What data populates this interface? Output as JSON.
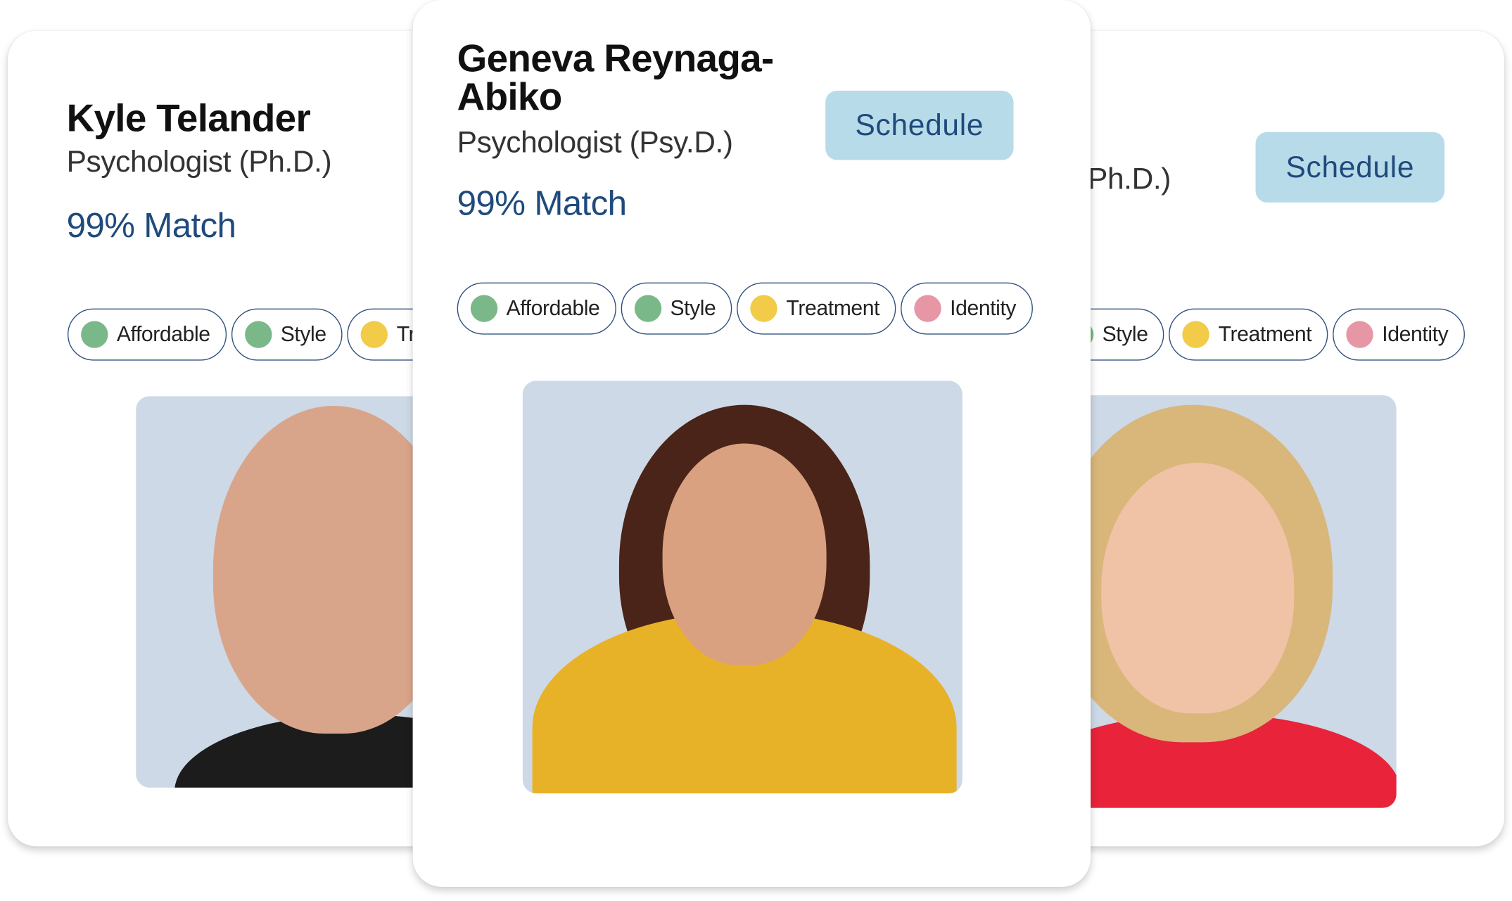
{
  "colors": {
    "accent": "#1f4a7c",
    "button_bg": "#b7dbe9",
    "green": "#7ab889",
    "yellow": "#f2cb48",
    "pink": "#e796a6",
    "photo_bg": "#cdd9e6"
  },
  "cards": [
    {
      "name": "Kyle Telander",
      "role": "Psychologist (Ph.D.)",
      "match": "99% Match",
      "chips": [
        {
          "label": "Affordable",
          "color": "green"
        },
        {
          "label": "Style",
          "color": "green"
        },
        {
          "label": "Treatment",
          "color": "yellow"
        }
      ]
    },
    {
      "name_line1": "Geneva Reynaga-",
      "name_line2": "Abiko",
      "role": "Psychologist (Psy.D.)",
      "match": "99% Match",
      "schedule": "Schedule",
      "chips": [
        {
          "label": "Affordable",
          "color": "green"
        },
        {
          "label": "Style",
          "color": "green"
        },
        {
          "label": "Treatment",
          "color": "yellow"
        },
        {
          "label": "Identity",
          "color": "pink"
        }
      ]
    },
    {
      "role": "Ph.D.)",
      "schedule": "Schedule",
      "chips": [
        {
          "label": "Style",
          "color": "green"
        },
        {
          "label": "Treatment",
          "color": "yellow"
        },
        {
          "label": "Identity",
          "color": "pink"
        }
      ]
    }
  ]
}
